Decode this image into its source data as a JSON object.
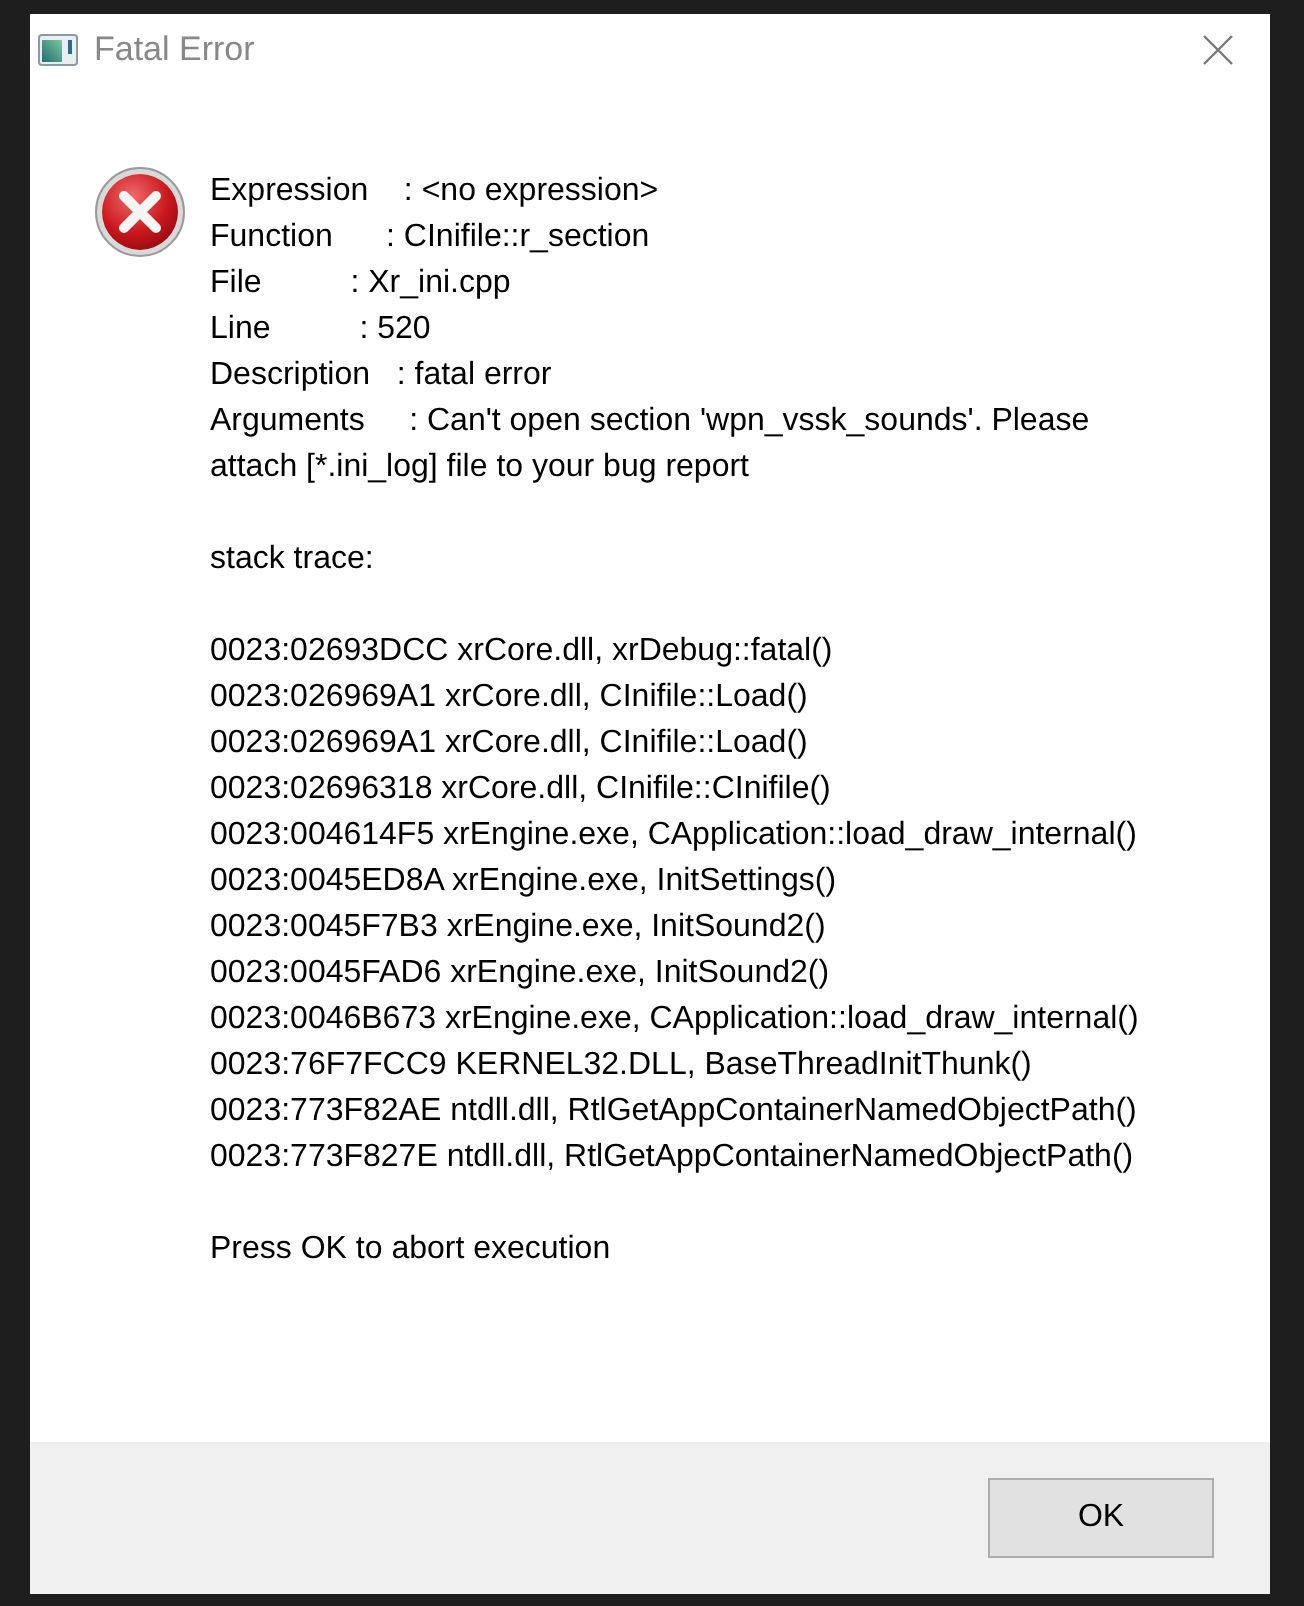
{
  "window": {
    "title": "Fatal Error"
  },
  "details": [
    "Expression    : <no expression>",
    "Function      : CInifile::r_section",
    "File          : Xr_ini.cpp",
    "Line          : 520",
    "Description   : fatal error",
    "Arguments     : Can't open section 'wpn_vssk_sounds'. Please attach [*.ini_log] file to your bug report"
  ],
  "stack_heading": "stack trace:",
  "stack_trace": [
    "0023:02693DCC xrCore.dll, xrDebug::fatal()",
    "0023:026969A1 xrCore.dll, CInifile::Load()",
    "0023:026969A1 xrCore.dll, CInifile::Load()",
    "0023:02696318 xrCore.dll, CInifile::CInifile()",
    "0023:004614F5 xrEngine.exe, CApplication::load_draw_internal()",
    "0023:0045ED8A xrEngine.exe, InitSettings()",
    "0023:0045F7B3 xrEngine.exe, InitSound2()",
    "0023:0045FAD6 xrEngine.exe, InitSound2()",
    "0023:0046B673 xrEngine.exe, CApplication::load_draw_internal()",
    "0023:76F7FCC9 KERNEL32.DLL, BaseThreadInitThunk()",
    "0023:773F82AE ntdll.dll, RtlGetAppContainerNamedObjectPath()",
    "0023:773F827E ntdll.dll, RtlGetAppContainerNamedObjectPath()"
  ],
  "prompt": "Press OK to abort execution",
  "buttons": [
    {
      "label": "OK"
    }
  ]
}
